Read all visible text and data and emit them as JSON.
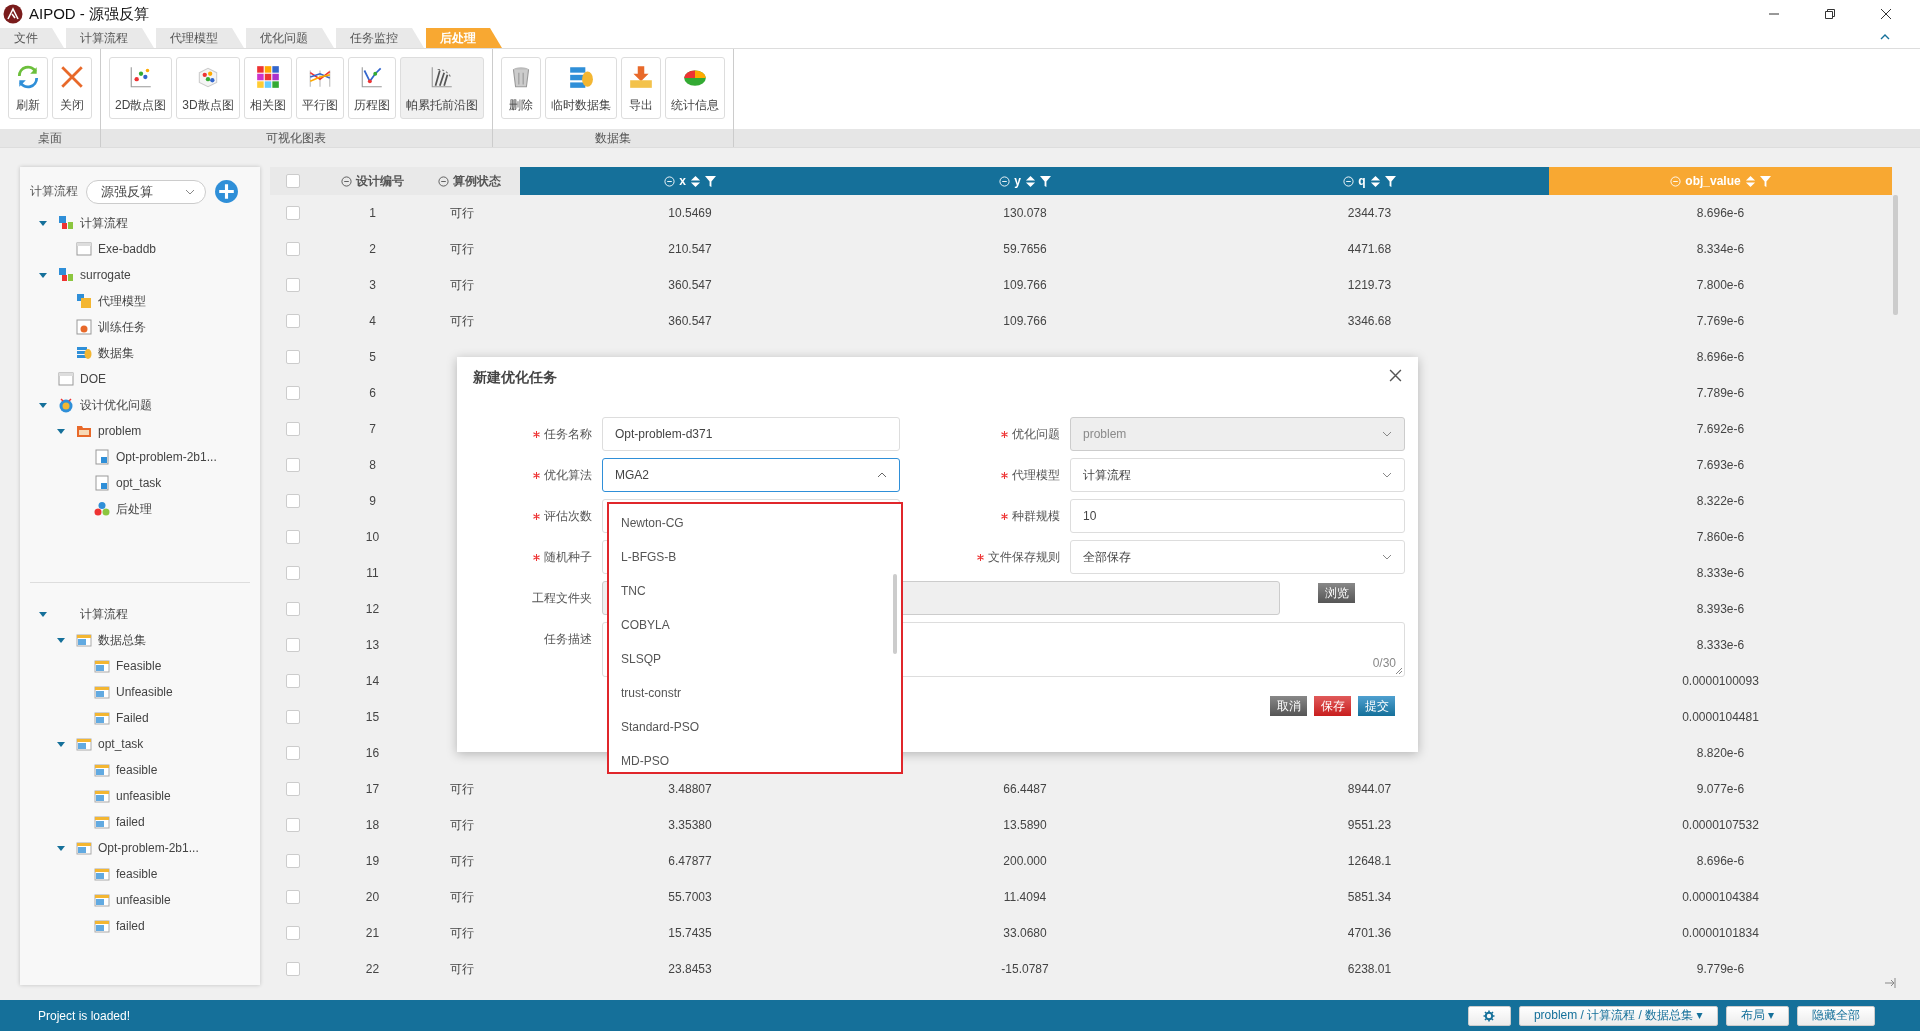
{
  "window": {
    "title": "AIPOD - 源强反算"
  },
  "menu_tabs": [
    {
      "label": "文件",
      "selected": false
    },
    {
      "label": "计算流程",
      "selected": false
    },
    {
      "label": "代理模型",
      "selected": false
    },
    {
      "label": "优化问题",
      "selected": false
    },
    {
      "label": "任务监控",
      "selected": false
    },
    {
      "label": "后处理",
      "selected": true
    }
  ],
  "ribbon": [
    {
      "label": "桌面",
      "buttons": [
        {
          "label": "刷新",
          "kind": "refresh",
          "highlighted": false
        },
        {
          "label": "关闭",
          "kind": "close",
          "highlighted": false
        }
      ]
    },
    {
      "label": "可视化图表",
      "buttons": [
        {
          "label": "2D散点图",
          "kind": "scatter2d",
          "highlighted": false
        },
        {
          "label": "3D散点图",
          "kind": "scatter3d",
          "highlighted": false
        },
        {
          "label": "相关图",
          "kind": "heatmap",
          "highlighted": false
        },
        {
          "label": "平行图",
          "kind": "parallel",
          "highlighted": false
        },
        {
          "label": "历程图",
          "kind": "history",
          "highlighted": false
        },
        {
          "label": "帕累托前沿图",
          "kind": "pareto",
          "highlighted": true
        }
      ]
    },
    {
      "label": "数据集",
      "buttons": [
        {
          "label": "删除",
          "kind": "delete",
          "highlighted": false
        },
        {
          "label": "临时数据集",
          "kind": "dataset",
          "highlighted": false
        },
        {
          "label": "导出",
          "kind": "export",
          "highlighted": false
        },
        {
          "label": "统计信息",
          "kind": "stats",
          "highlighted": false
        }
      ]
    }
  ],
  "sidebar": {
    "label": "计算流程",
    "select_value": "源强反算",
    "tree": [
      {
        "label": "计算流程",
        "kind": "flow",
        "expanded": true,
        "children": [
          {
            "label": "Exe-baddb",
            "kind": "window"
          }
        ]
      },
      {
        "label": "surrogate",
        "kind": "flow",
        "expanded": true,
        "children": [
          {
            "label": "代理模型",
            "kind": "model"
          },
          {
            "label": "训练任务",
            "kind": "task"
          },
          {
            "label": "数据集",
            "kind": "dataset"
          }
        ]
      },
      {
        "label": "DOE",
        "kind": "window"
      },
      {
        "label": "设计优化问题",
        "kind": "question",
        "expanded": true,
        "children": [
          {
            "label": "problem",
            "kind": "folder",
            "expanded": true,
            "children": [
              {
                "label": "Opt-problem-2b1...",
                "kind": "doc"
              },
              {
                "label": "opt_task",
                "kind": "doc"
              },
              {
                "label": "后处理",
                "kind": "dots"
              }
            ]
          }
        ]
      }
    ],
    "data_tree": [
      {
        "label": "计算流程",
        "kind": "none",
        "expanded": true,
        "children": [
          {
            "label": "数据总集",
            "kind": "table",
            "expanded": true,
            "children": [
              {
                "label": "Feasible",
                "kind": "table"
              },
              {
                "label": "Unfeasible",
                "kind": "table"
              },
              {
                "label": "Failed",
                "kind": "table"
              }
            ]
          },
          {
            "label": "opt_task",
            "kind": "table",
            "expanded": true,
            "children": [
              {
                "label": "feasible",
                "kind": "table"
              },
              {
                "label": "unfeasible",
                "kind": "table"
              },
              {
                "label": "failed",
                "kind": "table"
              }
            ]
          },
          {
            "label": "Opt-problem-2b1...",
            "kind": "table",
            "expanded": true,
            "children": [
              {
                "label": "feasible",
                "kind": "table"
              },
              {
                "label": "unfeasible",
                "kind": "table"
              },
              {
                "label": "failed",
                "kind": "table"
              }
            ]
          }
        ]
      }
    ]
  },
  "table": {
    "select_all": {
      "checked": false
    },
    "columns": [
      {
        "label": "设计编号",
        "kind": "plain"
      },
      {
        "label": "算例状态",
        "kind": "plain"
      },
      {
        "label": "x",
        "kind": "variable"
      },
      {
        "label": "y",
        "kind": "variable"
      },
      {
        "label": "q",
        "kind": "variable"
      },
      {
        "label": "obj_value",
        "kind": "objective"
      }
    ],
    "rows": [
      {
        "checked": false,
        "cells": [
          "1",
          "可行",
          "10.5469",
          "130.078",
          "2344.73",
          "8.696e-6"
        ]
      },
      {
        "checked": false,
        "cells": [
          "2",
          "可行",
          "210.547",
          "59.7656",
          "4471.68",
          "8.334e-6"
        ]
      },
      {
        "checked": false,
        "cells": [
          "3",
          "可行",
          "360.547",
          "109.766",
          "1219.73",
          "7.800e-6"
        ]
      },
      {
        "checked": false,
        "cells": [
          "4",
          "可行",
          "360.547",
          "109.766",
          "3346.68",
          "7.769e-6"
        ]
      },
      {
        "checked": false,
        "cells": [
          "5",
          null,
          null,
          null,
          null,
          "8.696e-6"
        ]
      },
      {
        "checked": false,
        "cells": [
          "6",
          null,
          null,
          null,
          null,
          "7.789e-6"
        ]
      },
      {
        "checked": false,
        "cells": [
          "7",
          null,
          null,
          null,
          null,
          "7.692e-6"
        ]
      },
      {
        "checked": false,
        "cells": [
          "8",
          null,
          null,
          null,
          null,
          "7.693e-6"
        ]
      },
      {
        "checked": false,
        "cells": [
          "9",
          null,
          null,
          null,
          null,
          "8.322e-6"
        ]
      },
      {
        "checked": false,
        "cells": [
          "10",
          null,
          null,
          null,
          null,
          "7.860e-6"
        ]
      },
      {
        "checked": false,
        "cells": [
          "11",
          null,
          null,
          null,
          null,
          "8.333e-6"
        ]
      },
      {
        "checked": false,
        "cells": [
          "12",
          null,
          null,
          null,
          null,
          "8.393e-6"
        ]
      },
      {
        "checked": false,
        "cells": [
          "13",
          null,
          null,
          null,
          null,
          "8.333e-6"
        ]
      },
      {
        "checked": false,
        "cells": [
          "14",
          null,
          null,
          null,
          null,
          "0.0000100093"
        ]
      },
      {
        "checked": false,
        "cells": [
          "15",
          null,
          null,
          null,
          null,
          "0.0000104481"
        ]
      },
      {
        "checked": false,
        "cells": [
          "16",
          null,
          null,
          null,
          null,
          "8.820e-6"
        ]
      },
      {
        "checked": false,
        "cells": [
          "17",
          "可行",
          "3.48807",
          "66.4487",
          "8944.07",
          "9.077e-6"
        ]
      },
      {
        "checked": false,
        "cells": [
          "18",
          "可行",
          "3.35380",
          "13.5890",
          "9551.23",
          "0.0000107532"
        ]
      },
      {
        "checked": false,
        "cells": [
          "19",
          "可行",
          "6.47877",
          "200.000",
          "12648.1",
          "8.696e-6"
        ]
      },
      {
        "checked": false,
        "cells": [
          "20",
          "可行",
          "55.7003",
          "11.4094",
          "5851.34",
          "0.0000104384"
        ]
      },
      {
        "checked": false,
        "cells": [
          "21",
          "可行",
          "15.7435",
          "33.0680",
          "4701.36",
          "0.0000101834"
        ]
      },
      {
        "checked": false,
        "cells": [
          "22",
          "可行",
          "23.8453",
          "-15.0787",
          "6238.01",
          "9.779e-6"
        ]
      }
    ]
  },
  "dialog": {
    "title": "新建优化任务",
    "fields": [
      {
        "label": "任务名称",
        "required": true,
        "kind": "text",
        "value": "Opt-problem-d371"
      },
      {
        "label": "优化问题",
        "required": true,
        "kind": "select",
        "value": "problem",
        "disabled": true,
        "expanded": false
      },
      {
        "label": "优化算法",
        "required": true,
        "kind": "select",
        "value": "MGA2",
        "disabled": false,
        "expanded": true,
        "options": [
          {
            "label": "Newton-CG",
            "selected": false
          },
          {
            "label": "L-BFGS-B",
            "selected": false
          },
          {
            "label": "TNC",
            "selected": false
          },
          {
            "label": "COBYLA",
            "selected": false
          },
          {
            "label": "SLSQP",
            "selected": false
          },
          {
            "label": "trust-constr",
            "selected": false
          },
          {
            "label": "Standard-PSO",
            "selected": false
          },
          {
            "label": "MD-PSO",
            "selected": false
          }
        ]
      },
      {
        "label": "代理模型",
        "required": true,
        "kind": "select",
        "value": "计算流程",
        "disabled": false,
        "expanded": false
      },
      {
        "label": "评估次数",
        "required": true,
        "kind": "text"
      },
      {
        "label": "种群规模",
        "required": true,
        "kind": "text",
        "value": "10"
      },
      {
        "label": "随机种子",
        "required": true,
        "kind": "text"
      },
      {
        "label": "文件保存规则",
        "required": true,
        "kind": "select",
        "value": "全部保存",
        "disabled": false,
        "expanded": false
      },
      {
        "label": "工程文件夹",
        "required": false,
        "kind": "folder",
        "disabled": true,
        "button": "浏览"
      },
      {
        "label": "任务描述",
        "required": false,
        "kind": "textarea",
        "counter": "0/30"
      }
    ],
    "buttons": [
      {
        "label": "取消",
        "kind": "cancel"
      },
      {
        "label": "保存",
        "kind": "save"
      },
      {
        "label": "提交",
        "kind": "submit"
      }
    ]
  },
  "status_bar": {
    "message": "Project is loaded!",
    "buttons": [
      {
        "label": "problem / 计算流程 / 数据总集 ▾"
      },
      {
        "label": "布局 ▾"
      },
      {
        "label": "隐藏全部"
      }
    ]
  }
}
